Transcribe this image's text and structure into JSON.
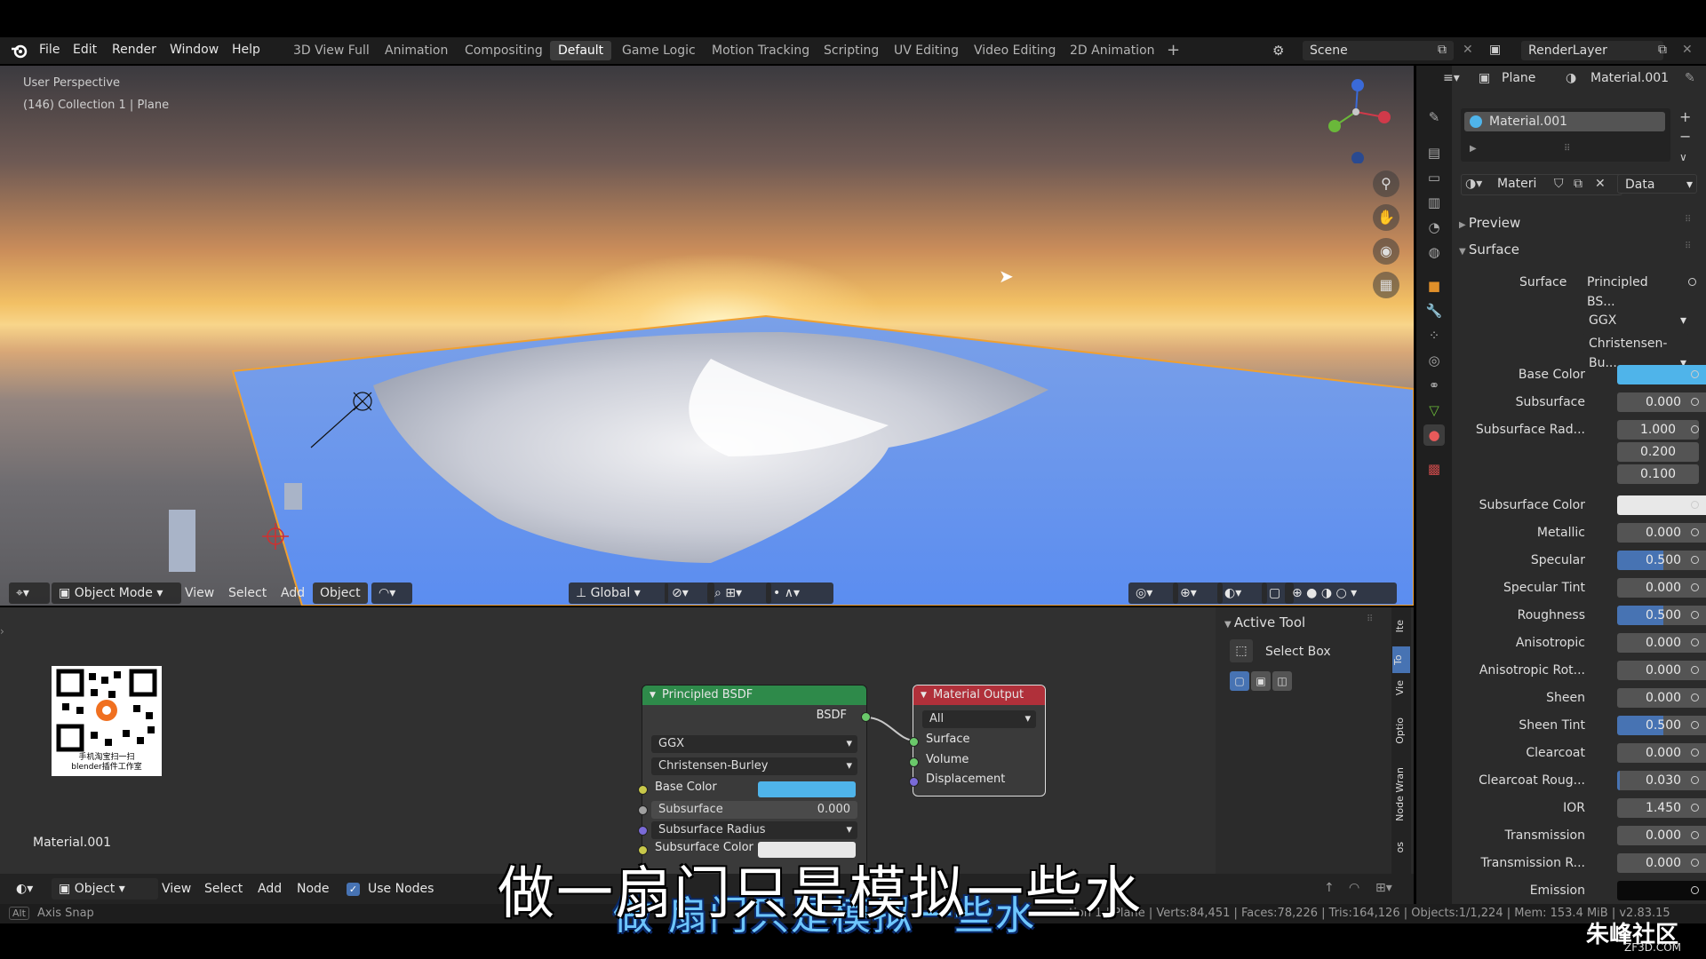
{
  "menu": [
    "File",
    "Edit",
    "Render",
    "Window",
    "Help"
  ],
  "workspace_tabs": [
    "3D View Full",
    "Animation",
    "Compositing",
    "Default",
    "Game Logic",
    "Motion Tracking",
    "Scripting",
    "UV Editing",
    "Video Editing",
    "2D Animation"
  ],
  "active_workspace": "Default",
  "scene": {
    "label": "Scene",
    "render_layer": "RenderLayer"
  },
  "viewport": {
    "perspective": "User Perspective",
    "collection": "(146) Collection 1 | Plane",
    "mode": "Object Mode",
    "menus": [
      "View",
      "Select",
      "Add",
      "Object"
    ],
    "orientation": "Global"
  },
  "properties": {
    "object": "Plane",
    "material": "Material.001",
    "slot": "Material.001",
    "mat_short": "Materi",
    "link": "Data",
    "sections": [
      "Preview",
      "Surface"
    ],
    "surface_label": "Surface",
    "surface_value": "Principled BS...",
    "distribution": "GGX",
    "subsurface_method": "Christensen-Bu...",
    "rows": [
      {
        "label": "Base Color",
        "value": "",
        "type": "color",
        "color": "#4fb4ea"
      },
      {
        "label": "Subsurface",
        "value": "0.000",
        "type": "num"
      },
      {
        "label": "Subsurface Rad...",
        "value": "1.000",
        "type": "num"
      },
      {
        "label": "",
        "value": "0.200",
        "type": "num"
      },
      {
        "label": "",
        "value": "0.100",
        "type": "num"
      },
      {
        "label": "Subsurface Color",
        "value": "",
        "type": "color",
        "color": "#e8e8e8"
      },
      {
        "label": "Metallic",
        "value": "0.000",
        "type": "num"
      },
      {
        "label": "Specular",
        "value": "0.500",
        "type": "blue"
      },
      {
        "label": "Specular Tint",
        "value": "0.000",
        "type": "num"
      },
      {
        "label": "Roughness",
        "value": "0.500",
        "type": "blue"
      },
      {
        "label": "Anisotropic",
        "value": "0.000",
        "type": "num"
      },
      {
        "label": "Anisotropic Rot...",
        "value": "0.000",
        "type": "num"
      },
      {
        "label": "Sheen",
        "value": "0.000",
        "type": "num"
      },
      {
        "label": "Sheen Tint",
        "value": "0.500",
        "type": "blue"
      },
      {
        "label": "Clearcoat",
        "value": "0.000",
        "type": "num"
      },
      {
        "label": "Clearcoat Roug...",
        "value": "0.030",
        "type": "blue3"
      },
      {
        "label": "IOR",
        "value": "1.450",
        "type": "num"
      },
      {
        "label": "Transmission",
        "value": "0.000",
        "type": "num"
      },
      {
        "label": "Transmission R...",
        "value": "0.000",
        "type": "num"
      },
      {
        "label": "Emission",
        "value": "",
        "type": "color",
        "color": "#0a0a0a"
      }
    ]
  },
  "node_editor": {
    "material_name": "Material.001",
    "qr_caption": "手机淘宝扫一扫\nblender插件工作室",
    "bsdf": {
      "title": "Principled BSDF",
      "output": "BSDF",
      "distribution": "GGX",
      "subsurface_method": "Christensen-Burley",
      "base_color": "Base Color",
      "subsurface": "Subsurface",
      "subsurface_value": "0.000",
      "subsurface_radius": "Subsurface Radius",
      "subsurface_color": "Subsurface Color"
    },
    "output": {
      "title": "Material Output",
      "target": "All",
      "inputs": [
        "Surface",
        "Volume",
        "Displacement"
      ]
    },
    "header": {
      "type": "Object",
      "menus": [
        "View",
        "Select",
        "Add",
        "Node"
      ],
      "use_nodes": "Use Nodes"
    }
  },
  "tool_panel": {
    "title": "Active Tool",
    "tool": "Select Box",
    "side_tabs": [
      "Ite",
      "To",
      "Vie",
      "Optio",
      "Node Wran",
      "os"
    ]
  },
  "status": {
    "axis_snap": "Axis Snap",
    "alt": "Alt",
    "stats": "ction 1 | Plane | Verts:84,451 | Faces:78,226 | Tris:164,126 | Objects:1/1,224 | Mem: 153.4 MiB | v2.83.15"
  },
  "subtitle": "做一扇门只是模拟一些水",
  "subtitle_secondary": "做 扇门只是模拟一些水",
  "watermark": "朱峰社区",
  "watermark_sub": "ZF3D.COM"
}
